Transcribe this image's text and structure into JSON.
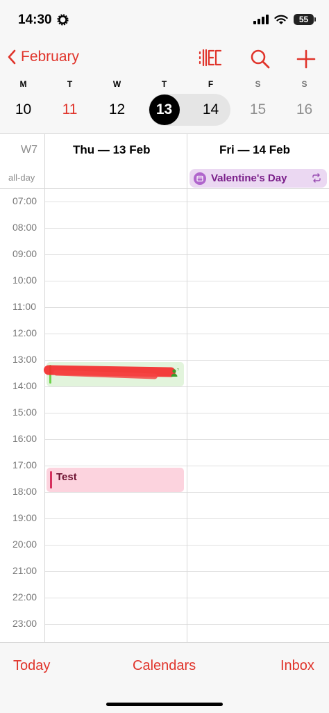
{
  "status_bar": {
    "time": "14:30",
    "battery": "55"
  },
  "header": {
    "back_label": "February",
    "icons": [
      "list-view-icon",
      "search-icon",
      "add-icon"
    ]
  },
  "week": {
    "days": [
      {
        "letter": "M",
        "num": "10",
        "style": "normal"
      },
      {
        "letter": "T",
        "num": "11",
        "style": "red"
      },
      {
        "letter": "W",
        "num": "12",
        "style": "normal"
      },
      {
        "letter": "T",
        "num": "13",
        "style": "selected"
      },
      {
        "letter": "F",
        "num": "14",
        "style": "normal"
      },
      {
        "letter": "S",
        "num": "15",
        "style": "gray"
      },
      {
        "letter": "S",
        "num": "16",
        "style": "gray"
      }
    ]
  },
  "columns": {
    "week_label": "W7",
    "allday_label": "all-day",
    "col1": "Thu — 13 Feb",
    "col2": "Fri — 14 Feb"
  },
  "allday_event": {
    "title": "Valentine's Day",
    "color": "#b065cc"
  },
  "hours": [
    "07:00",
    "08:00",
    "09:00",
    "10:00",
    "11:00",
    "12:00",
    "13:00",
    "14:00",
    "15:00",
    "16:00",
    "17:00",
    "18:00",
    "19:00",
    "20:00",
    "21:00",
    "22:00",
    "23:00"
  ],
  "events": {
    "redacted_color": "#6cd34a",
    "test_title": "Test",
    "test_color": "#d6305e"
  },
  "toolbar": {
    "today": "Today",
    "calendars": "Calendars",
    "inbox": "Inbox"
  },
  "colors": {
    "accent": "#e0342b"
  }
}
